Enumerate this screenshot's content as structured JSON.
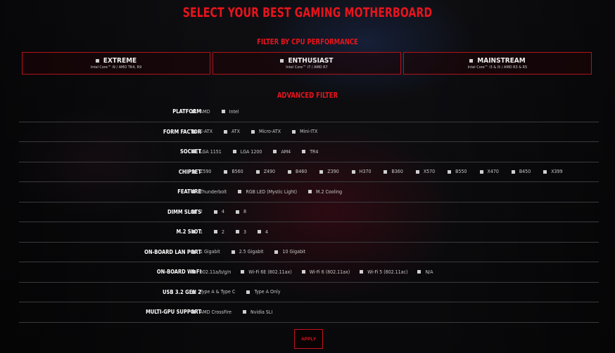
{
  "title": "SELECT YOUR BEST GAMING MOTHERBOARD",
  "cpu_filter": {
    "title": "FILTER BY CPU PERFORMANCE",
    "options": [
      {
        "label": "EXTREME",
        "sub": "Intel Core™ i9 / AMD TR4, R9"
      },
      {
        "label": "ENTHUSIAST",
        "sub": "Intel Core™ i7 / AMD R7"
      },
      {
        "label": "MAINSTREAM",
        "sub": "Intel Core™ i3 & i5 / AMD R3 & R5"
      }
    ]
  },
  "advanced_filter": {
    "title": "ADVANCED FILTER",
    "rows": [
      {
        "label": "PLATFORM",
        "options": [
          "AMD",
          "Intel"
        ]
      },
      {
        "label": "FORM FACTOR",
        "options": [
          "E-ATX",
          "ATX",
          "Micro-ATX",
          "Mini-ITX"
        ]
      },
      {
        "label": "SOCKET",
        "options": [
          "LGA 1151",
          "LGA 1200",
          "AM4",
          "TR4"
        ]
      },
      {
        "label": "CHIPSET",
        "options": [
          "Z590",
          "B560",
          "Z490",
          "B460",
          "Z390",
          "H370",
          "B360",
          "X570",
          "B550",
          "X470",
          "B450",
          "X399"
        ]
      },
      {
        "label": "FEATURE",
        "options": [
          "Thunderbolt",
          "RGB LED (Mystic Light)",
          "M.2 Cooling"
        ]
      },
      {
        "label": "DIMM SLOTS",
        "options": [
          "2",
          "4",
          "8"
        ]
      },
      {
        "label": "M.2 SLOT",
        "options": [
          "1",
          "2",
          "3",
          "4"
        ]
      },
      {
        "label": "ON-BOARD LAN PORT",
        "options": [
          "1 Gigabit",
          "2.5 Gigabit",
          "10 Gigabit"
        ]
      },
      {
        "label": "ON-BOARD WI-FI",
        "options": [
          "802.11a/b/g/n",
          "Wi-Fi 6E (802.11ax)",
          "Wi-Fi 6 (802.11ax)",
          "Wi-Fi 5 (802.11ac)",
          "N/A"
        ]
      },
      {
        "label": "USB 3.2 GEN 2",
        "options": [
          "Type A & Type C",
          "Type A Only"
        ]
      },
      {
        "label": "MULTI-GPU SUPPORT",
        "options": [
          "AMD CrossFire",
          "Nvidia SLI"
        ]
      }
    ]
  },
  "apply_label": "APPLY"
}
